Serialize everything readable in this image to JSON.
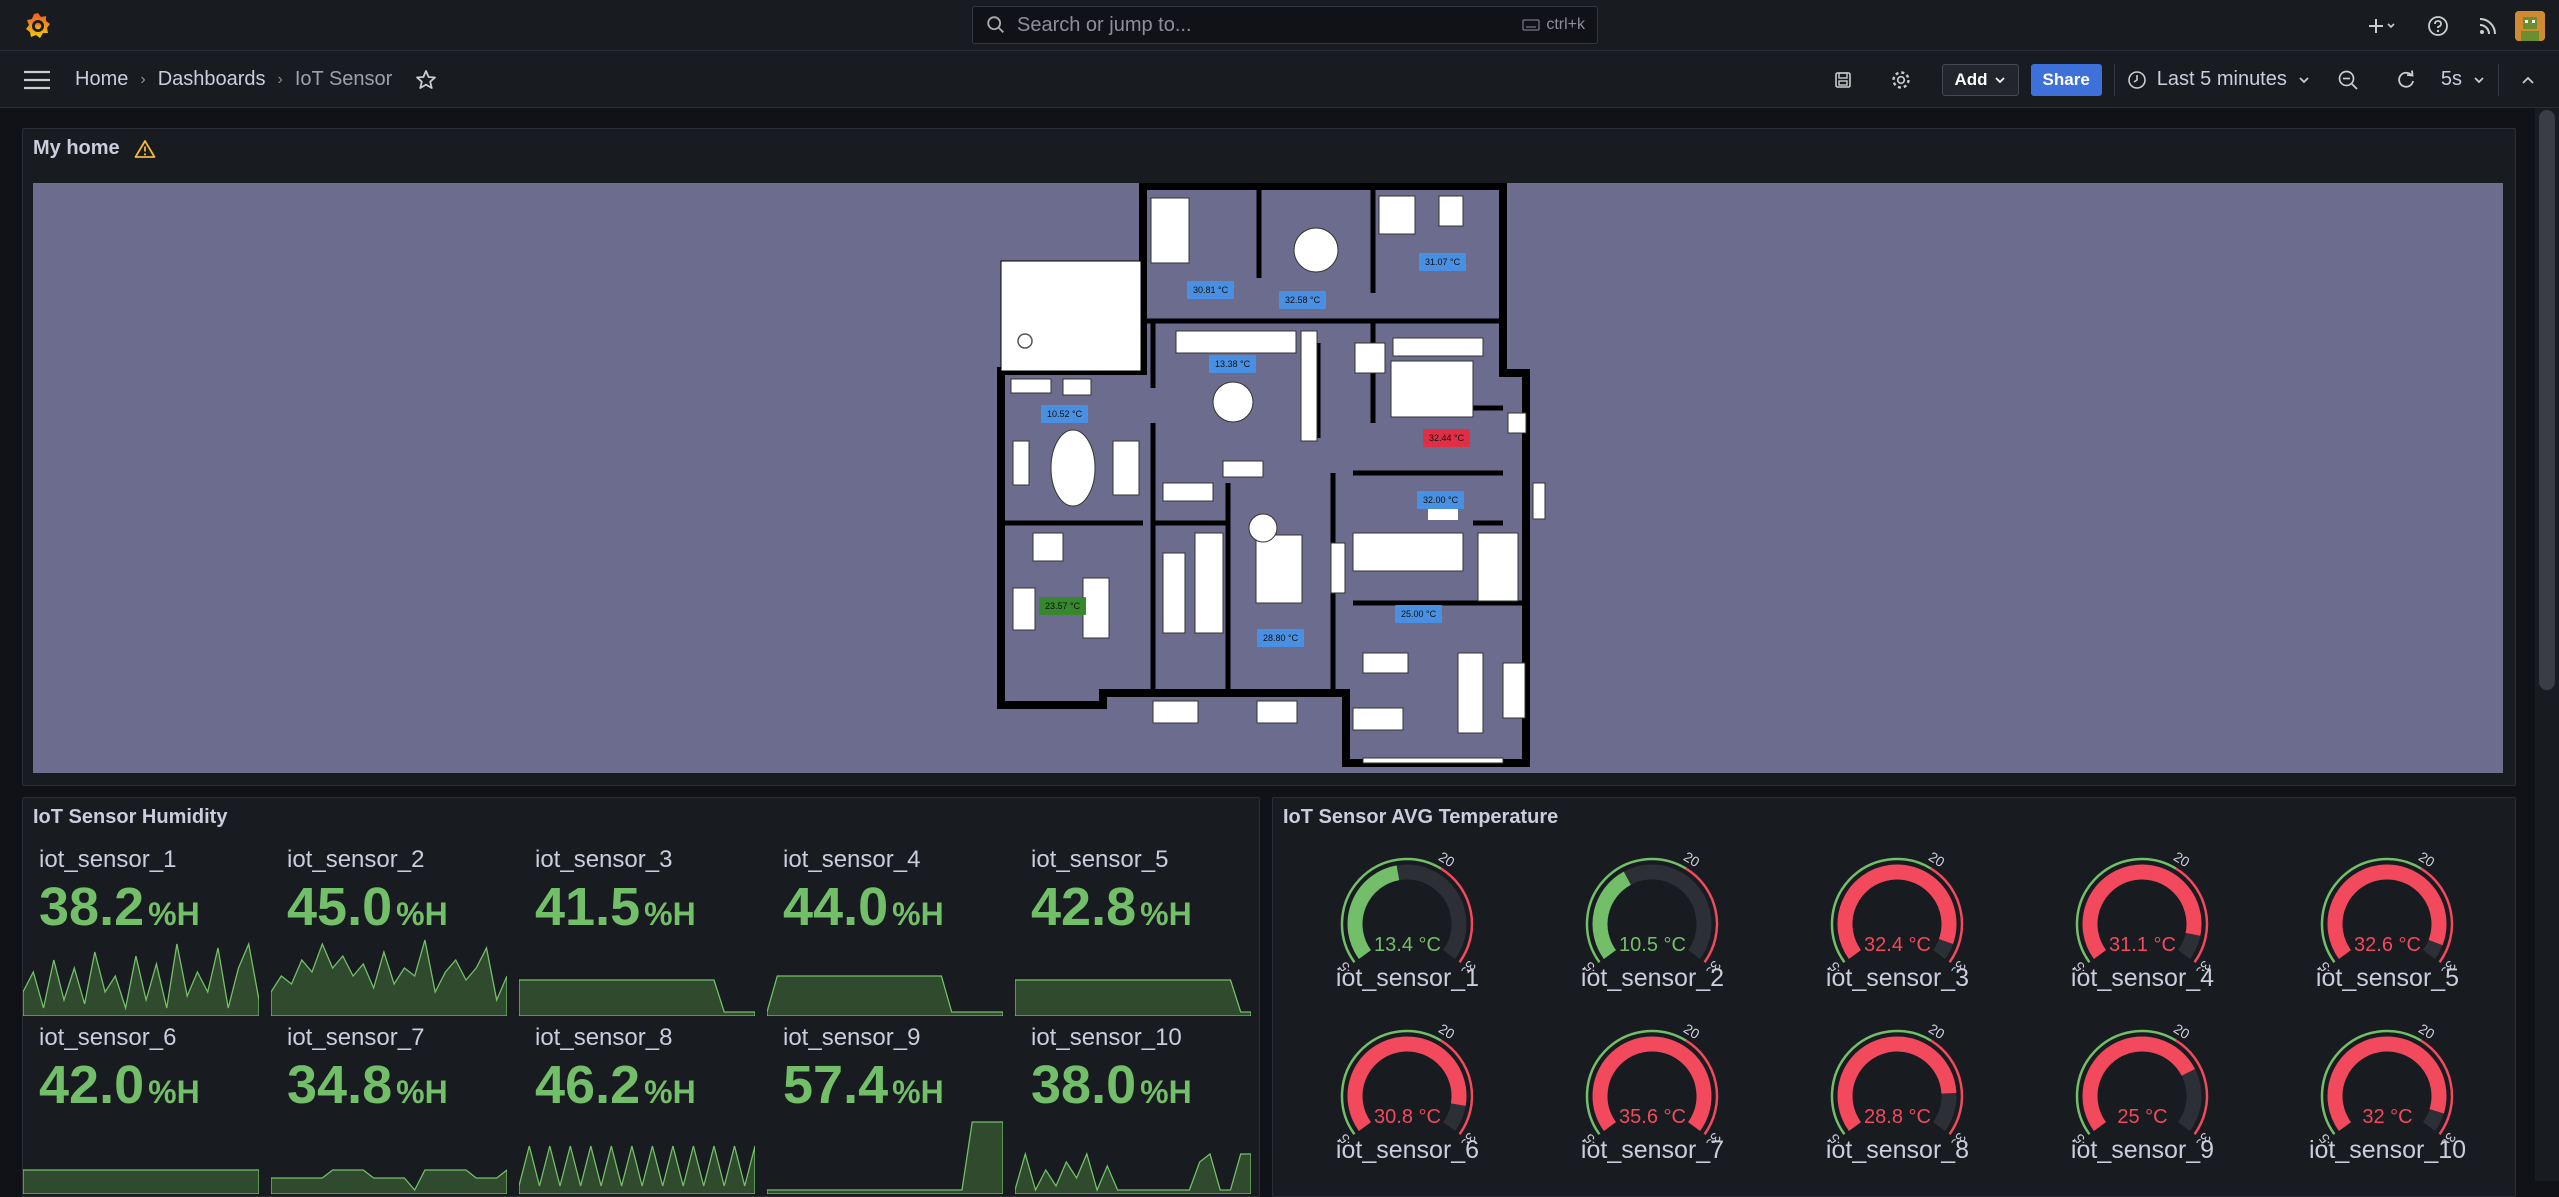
{
  "topbar": {
    "search_placeholder": "Search or jump to...",
    "search_shortcut": "ctrl+k"
  },
  "nav": {
    "breadcrumbs": [
      "Home",
      "Dashboards",
      "IoT Sensor"
    ],
    "add_label": "Add",
    "share_label": "Share",
    "time_range": "Last 5 minutes",
    "refresh_interval": "5s"
  },
  "panels": {
    "home": {
      "title": "My home",
      "temperature_labels": [
        {
          "text": "30.81 °C",
          "color": "#4a90e2"
        },
        {
          "text": "32.58 °C",
          "color": "#4a90e2"
        },
        {
          "text": "31.07 °C",
          "color": "#4a90e2"
        },
        {
          "text": "13.38 °C",
          "color": "#4a90e2"
        },
        {
          "text": "10.52 °C",
          "color": "#4a90e2"
        },
        {
          "text": "32.44 °C",
          "color": "#e02f44"
        },
        {
          "text": "32.00 °C",
          "color": "#4a90e2"
        },
        {
          "text": "25.00 °C",
          "color": "#4a90e2"
        },
        {
          "text": "28.80 °C",
          "color": "#4a90e2"
        },
        {
          "text": "23.57 °C",
          "color": "#37872d"
        }
      ]
    },
    "humidity": {
      "title": "IoT Sensor Humidity",
      "unit": "%H",
      "sensors": [
        {
          "name": "iot_sensor_1",
          "value": "38.2",
          "spark": [
            0.3,
            0.55,
            0.1,
            0.7,
            0.2,
            0.6,
            0.15,
            0.8,
            0.3,
            0.5,
            0.1,
            0.75,
            0.2,
            0.65,
            0.1,
            0.9,
            0.25,
            0.55,
            0.3,
            0.85,
            0.1,
            0.6,
            0.9,
            0.2
          ]
        },
        {
          "name": "iot_sensor_2",
          "value": "45.0",
          "spark": [
            0.3,
            0.5,
            0.4,
            0.7,
            0.55,
            0.9,
            0.6,
            0.75,
            0.5,
            0.65,
            0.35,
            0.8,
            0.4,
            0.6,
            0.5,
            0.95,
            0.3,
            0.55,
            0.7,
            0.45,
            0.6,
            0.85,
            0.2,
            0.5
          ]
        },
        {
          "name": "iot_sensor_3",
          "value": "41.5",
          "spark": [
            0.45,
            0.45,
            0.45,
            0.45,
            0.45,
            0.45,
            0.45,
            0.45,
            0.45,
            0.45,
            0.45,
            0.45,
            0.45,
            0.45,
            0.45,
            0.45,
            0.45,
            0.45,
            0.45,
            0.45,
            0.05,
            0.05,
            0.05,
            0.05
          ]
        },
        {
          "name": "iot_sensor_4",
          "value": "44.0",
          "spark": [
            0.05,
            0.5,
            0.5,
            0.5,
            0.5,
            0.5,
            0.5,
            0.5,
            0.5,
            0.5,
            0.5,
            0.5,
            0.5,
            0.5,
            0.5,
            0.5,
            0.5,
            0.5,
            0.05,
            0.05,
            0.05,
            0.05,
            0.05,
            0.05
          ]
        },
        {
          "name": "iot_sensor_5",
          "value": "42.8",
          "spark": [
            0.45,
            0.45,
            0.45,
            0.45,
            0.45,
            0.45,
            0.45,
            0.45,
            0.45,
            0.45,
            0.45,
            0.45,
            0.45,
            0.45,
            0.45,
            0.45,
            0.45,
            0.45,
            0.45,
            0.45,
            0.45,
            0.45,
            0.05,
            0.05
          ]
        },
        {
          "name": "iot_sensor_6",
          "value": "42.0",
          "spark": [
            0.3,
            0.3,
            0.3,
            0.3,
            0.3,
            0.3,
            0.3,
            0.3,
            0.3,
            0.3,
            0.3,
            0.3,
            0.3,
            0.3,
            0.3,
            0.3,
            0.3,
            0.3,
            0.3,
            0.3,
            0.3,
            0.3,
            0.3,
            0.3
          ]
        },
        {
          "name": "iot_sensor_7",
          "value": "34.8",
          "spark": [
            0.2,
            0.2,
            0.2,
            0.2,
            0.2,
            0.2,
            0.3,
            0.3,
            0.3,
            0.3,
            0.2,
            0.2,
            0.2,
            0.2,
            0.05,
            0.3,
            0.3,
            0.3,
            0.3,
            0.3,
            0.2,
            0.2,
            0.2,
            0.3
          ]
        },
        {
          "name": "iot_sensor_8",
          "value": "46.2",
          "spark": [
            0.1,
            0.6,
            0.1,
            0.6,
            0.1,
            0.6,
            0.1,
            0.6,
            0.1,
            0.6,
            0.1,
            0.6,
            0.1,
            0.6,
            0.1,
            0.6,
            0.1,
            0.6,
            0.1,
            0.6,
            0.1,
            0.6,
            0.1,
            0.6
          ]
        },
        {
          "name": "iot_sensor_9",
          "value": "57.4",
          "spark": [
            0.05,
            0.05,
            0.05,
            0.05,
            0.05,
            0.05,
            0.05,
            0.05,
            0.05,
            0.05,
            0.05,
            0.05,
            0.05,
            0.05,
            0.05,
            0.05,
            0.05,
            0.05,
            0.05,
            0.05,
            0.9,
            0.9,
            0.9,
            0.9
          ]
        },
        {
          "name": "iot_sensor_10",
          "value": "38.0",
          "spark": [
            0.05,
            0.5,
            0.05,
            0.3,
            0.1,
            0.4,
            0.2,
            0.5,
            0.05,
            0.35,
            0.05,
            0.05,
            0.05,
            0.05,
            0.05,
            0.05,
            0.05,
            0.05,
            0.4,
            0.5,
            0.05,
            0.05,
            0.5,
            0.5
          ]
        }
      ]
    },
    "temperature": {
      "title": "IoT Sensor AVG Temperature",
      "gauge_min": -5,
      "gauge_max": 35,
      "gauge_threshold": 20,
      "tick_labels": [
        "-5",
        "20",
        "35"
      ],
      "sensors": [
        {
          "name": "iot_sensor_1",
          "value": 13.4,
          "display": "13.4 °C"
        },
        {
          "name": "iot_sensor_2",
          "value": 10.5,
          "display": "10.5 °C"
        },
        {
          "name": "iot_sensor_3",
          "value": 32.4,
          "display": "32.4 °C"
        },
        {
          "name": "iot_sensor_4",
          "value": 31.1,
          "display": "31.1 °C"
        },
        {
          "name": "iot_sensor_5",
          "value": 32.6,
          "display": "32.6 °C"
        },
        {
          "name": "iot_sensor_6",
          "value": 30.8,
          "display": "30.8 °C"
        },
        {
          "name": "iot_sensor_7",
          "value": 35.6,
          "display": "35.6 °C"
        },
        {
          "name": "iot_sensor_8",
          "value": 28.8,
          "display": "28.8 °C"
        },
        {
          "name": "iot_sensor_9",
          "value": 25,
          "display": "25 °C"
        },
        {
          "name": "iot_sensor_10",
          "value": 32,
          "display": "32 °C"
        }
      ]
    }
  },
  "colors": {
    "green": "#73bf69",
    "red": "#f2495c",
    "accent": "#3d71d9"
  }
}
